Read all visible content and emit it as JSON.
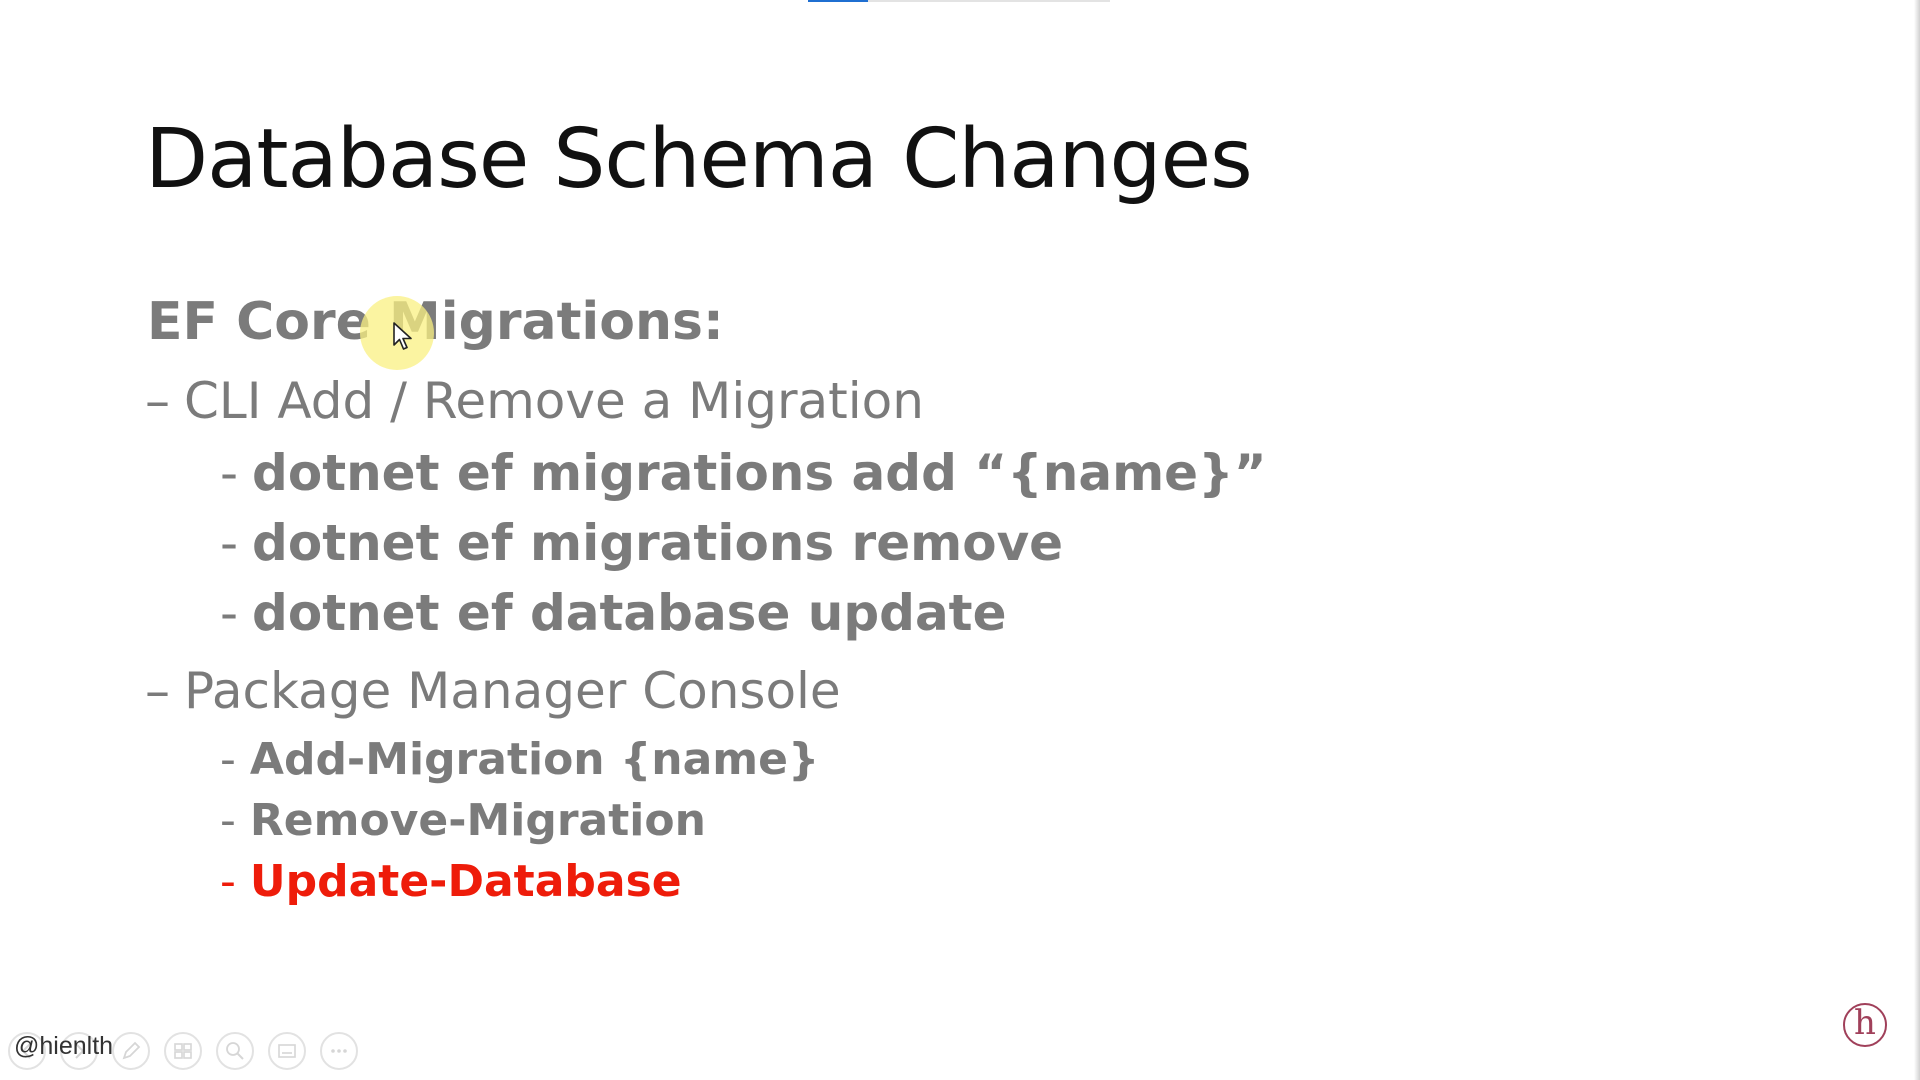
{
  "slide": {
    "title": "Database Schema Changes",
    "heading": "EF Core Migrations:",
    "sections": [
      {
        "label": "CLI Add / Remove a Migration",
        "items": [
          "dotnet ef migrations add “{name}”",
          "dotnet ef migrations remove",
          "dotnet ef database update"
        ]
      },
      {
        "label": "Package Manager Console",
        "items": [
          "Add-Migration {name}",
          "Remove-Migration",
          "Update-Database"
        ]
      }
    ],
    "level1_bullet": "–",
    "level2_bullet": "-",
    "highlight_color": "#ee1c0a",
    "text_color": "#7b7b7b"
  },
  "overlay": {
    "handle": "@hienlth",
    "logo_letter": "h",
    "toolbar_icons": [
      "back-icon",
      "forward-icon",
      "pen-icon",
      "slides-icon",
      "zoom-icon",
      "subtitles-icon",
      "more-icon"
    ]
  }
}
